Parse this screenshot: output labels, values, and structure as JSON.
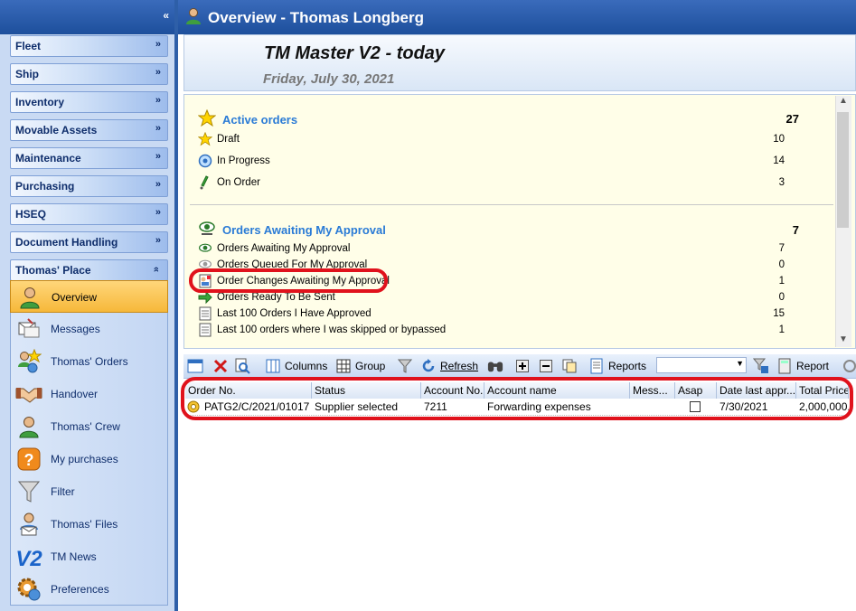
{
  "window": {
    "title": "Overview - Thomas Longberg"
  },
  "header": {
    "app_title": "TM Master V2 - today",
    "date": "Friday, July 30, 2021"
  },
  "sidebar": {
    "groups": [
      {
        "label": "Fleet"
      },
      {
        "label": "Ship"
      },
      {
        "label": "Inventory"
      },
      {
        "label": "Movable Assets"
      },
      {
        "label": "Maintenance"
      },
      {
        "label": "Purchasing"
      },
      {
        "label": "HSEQ"
      },
      {
        "label": "Document Handling"
      },
      {
        "label": "Thomas' Place"
      }
    ],
    "items": [
      {
        "label": "Overview",
        "icon": "person-icon"
      },
      {
        "label": "Messages",
        "icon": "messages-icon"
      },
      {
        "label": "Thomas' Orders",
        "icon": "orders-icon"
      },
      {
        "label": "Handover",
        "icon": "handshake-icon"
      },
      {
        "label": "Thomas' Crew",
        "icon": "crew-icon"
      },
      {
        "label": "My purchases",
        "icon": "question-icon"
      },
      {
        "label": "Filter",
        "icon": "funnel-icon"
      },
      {
        "label": "Thomas' Files",
        "icon": "files-icon"
      },
      {
        "label": "TM News",
        "icon": "v2-logo-icon"
      },
      {
        "label": "Preferences",
        "icon": "gear-icon"
      }
    ]
  },
  "summary": {
    "active_orders": {
      "title": "Active orders",
      "total": "27",
      "rows": [
        {
          "label": "Draft",
          "value": "10"
        },
        {
          "label": "In Progress",
          "value": "14"
        },
        {
          "label": "On Order",
          "value": "3"
        }
      ]
    },
    "awaiting": {
      "title": "Orders Awaiting My Approval",
      "total": "7",
      "rows": [
        {
          "label": "Orders Awaiting My Approval",
          "value": "7"
        },
        {
          "label": "Orders Queued For My Approval",
          "value": "0"
        },
        {
          "label": "Order Changes Awaiting My Approval",
          "value": "1"
        },
        {
          "label": "Orders Ready To Be Sent",
          "value": "0"
        },
        {
          "label": "Last 100 Orders I Have Approved",
          "value": "15"
        },
        {
          "label": "Last 100 orders where I was skipped or bypassed",
          "value": "1"
        }
      ]
    }
  },
  "toolbar": {
    "columns": "Columns",
    "group": "Group",
    "refresh": "Refresh",
    "reports": "Reports",
    "report": "Report"
  },
  "grid": {
    "columns": [
      "Order No.",
      "Status",
      "Account No.",
      "Account name",
      "Mess...",
      "Asap",
      "Date last appr...",
      "Total Price"
    ],
    "rows": [
      {
        "order_no": "PATG2/C/2021/01017",
        "status": "Supplier selected",
        "account_no": "7211",
        "account_name": "Forwarding expenses",
        "mess": "",
        "asap": "",
        "date": "7/30/2021",
        "total": "2,000,000..."
      }
    ]
  },
  "colors": {
    "title_bar": "#2556a3",
    "highlight_ring": "#e0121c",
    "section_title": "#2a7bd6",
    "active_nav": "#f6b83a"
  }
}
